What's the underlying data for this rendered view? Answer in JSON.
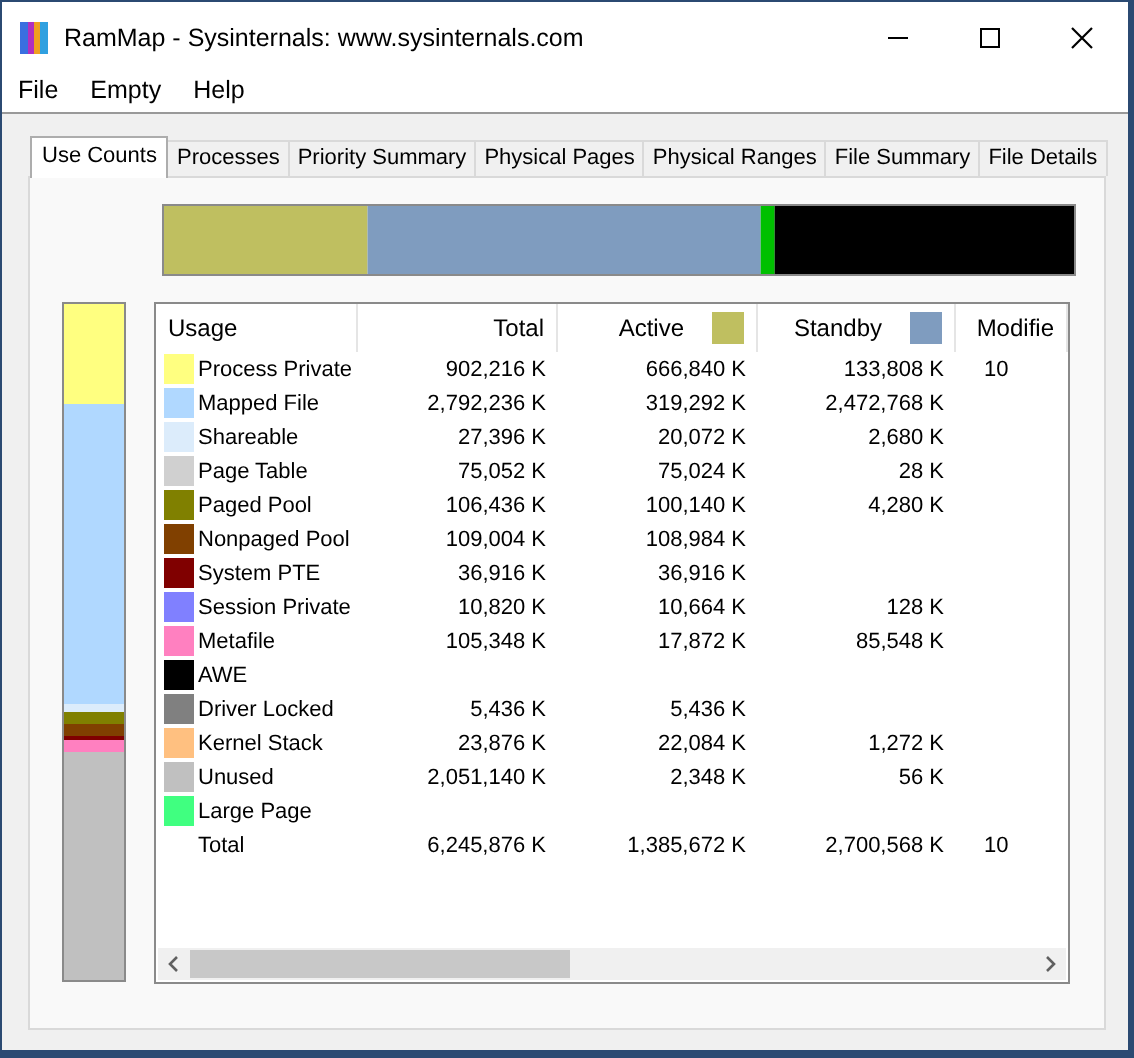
{
  "window": {
    "title": "RamMap - Sysinternals: www.sysinternals.com"
  },
  "menu": [
    "File",
    "Empty",
    "Help"
  ],
  "tabs": [
    {
      "label": "Use Counts",
      "selected": true
    },
    {
      "label": "Processes",
      "selected": false
    },
    {
      "label": "Priority Summary",
      "selected": false
    },
    {
      "label": "Physical Pages",
      "selected": false
    },
    {
      "label": "Physical Ranges",
      "selected": false
    },
    {
      "label": "File Summary",
      "selected": false
    },
    {
      "label": "File Details",
      "selected": false
    }
  ],
  "table": {
    "columns": [
      {
        "label": "Usage"
      },
      {
        "label": "Total"
      },
      {
        "label": "Active",
        "color": "#bfbf60"
      },
      {
        "label": "Standby",
        "color": "#7f9cbf"
      },
      {
        "label": "Modifie"
      }
    ],
    "rows": [
      {
        "color": "#ffff80",
        "cells": [
          "Process Private",
          "902,216 K",
          "666,840 K",
          "133,808 K",
          "10"
        ]
      },
      {
        "color": "#b0d8ff",
        "cells": [
          "Mapped File",
          "2,792,236 K",
          "319,292 K",
          "2,472,768 K",
          ""
        ]
      },
      {
        "color": "#dcecfb",
        "cells": [
          "Shareable",
          "27,396 K",
          "20,072 K",
          "2,680 K",
          ""
        ]
      },
      {
        "color": "#d0d0d0",
        "cells": [
          "Page Table",
          "75,052 K",
          "75,024 K",
          "28 K",
          ""
        ]
      },
      {
        "color": "#808000",
        "cells": [
          "Paged Pool",
          "106,436 K",
          "100,140 K",
          "4,280 K",
          ""
        ]
      },
      {
        "color": "#804000",
        "cells": [
          "Nonpaged Pool",
          "109,004 K",
          "108,984 K",
          "",
          ""
        ]
      },
      {
        "color": "#800000",
        "cells": [
          "System PTE",
          "36,916 K",
          "36,916 K",
          "",
          ""
        ]
      },
      {
        "color": "#8080ff",
        "cells": [
          "Session Private",
          "10,820 K",
          "10,664 K",
          "128 K",
          ""
        ]
      },
      {
        "color": "#ff80c0",
        "cells": [
          "Metafile",
          "105,348 K",
          "17,872 K",
          "85,548 K",
          ""
        ]
      },
      {
        "color": "#000000",
        "cells": [
          "AWE",
          "",
          "",
          "",
          ""
        ]
      },
      {
        "color": "#808080",
        "cells": [
          "Driver Locked",
          "5,436 K",
          "5,436 K",
          "",
          ""
        ]
      },
      {
        "color": "#ffc080",
        "cells": [
          "Kernel Stack",
          "23,876 K",
          "22,084 K",
          "1,272 K",
          ""
        ]
      },
      {
        "color": "#c0c0c0",
        "cells": [
          "Unused",
          "2,051,140 K",
          "2,348 K",
          "56 K",
          ""
        ]
      },
      {
        "color": "#40ff80",
        "cells": [
          "Large Page",
          "",
          "",
          "",
          ""
        ]
      },
      {
        "cells": [
          "Total",
          "6,245,876 K",
          "1,385,672 K",
          "2,700,568 K",
          "10"
        ]
      }
    ]
  }
}
